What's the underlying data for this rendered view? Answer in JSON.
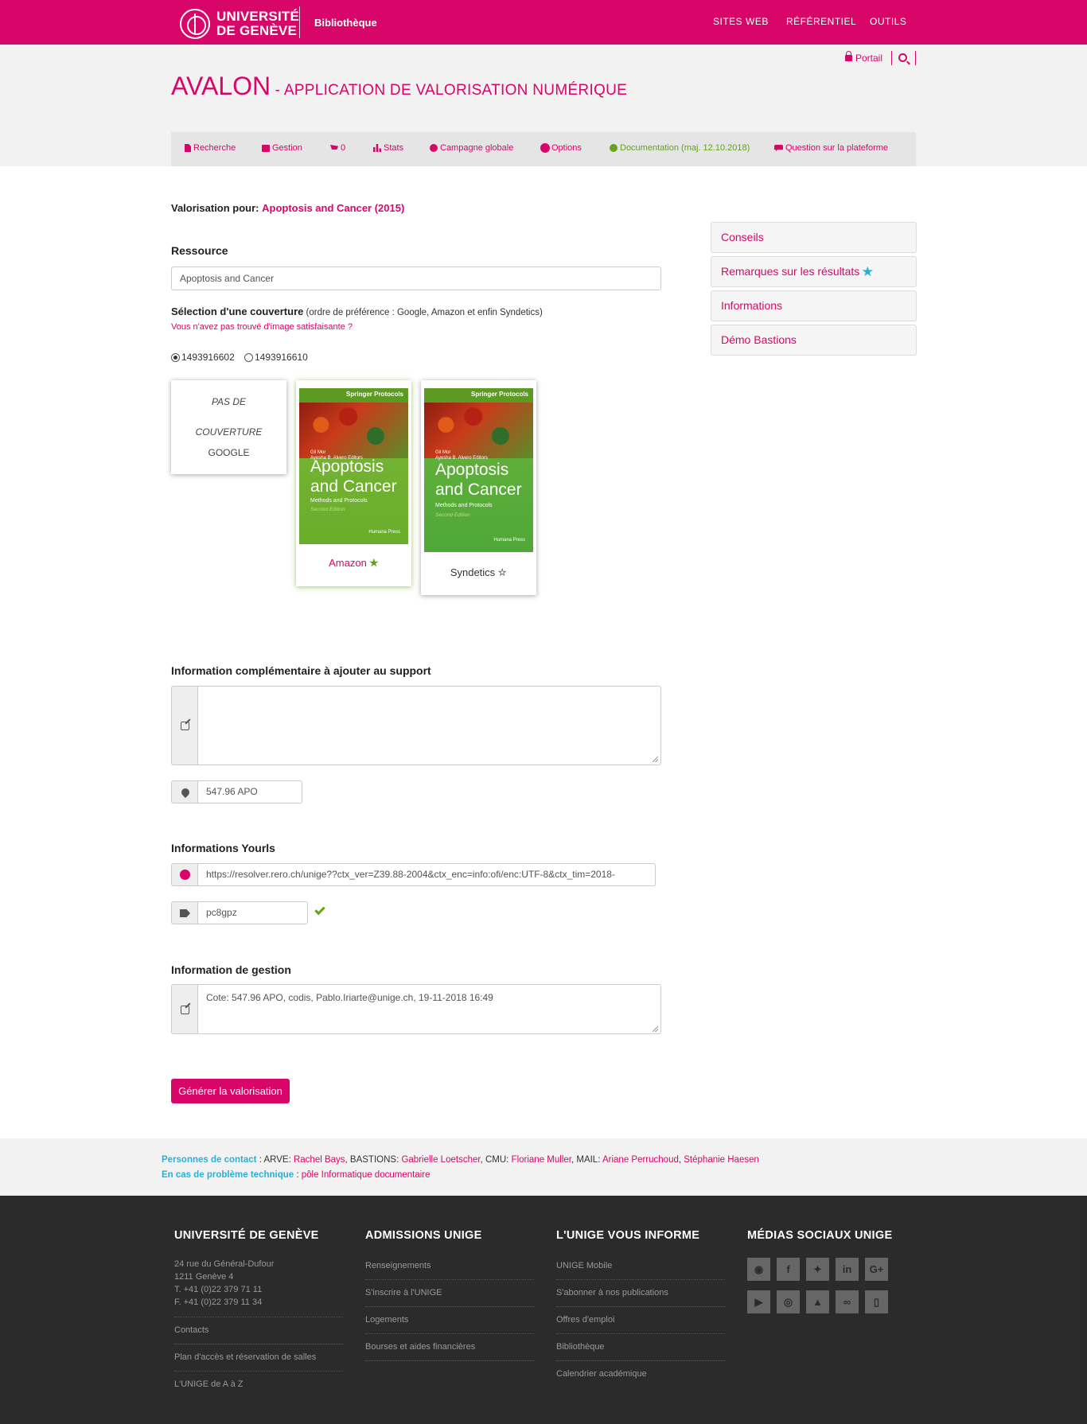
{
  "topbar": {
    "logo_line1": "UNIVERSITÉ",
    "logo_line2": "DE GENÈVE",
    "section": "Bibliothèque",
    "nav": [
      "SITES WEB",
      "RÉFÉRENTIEL",
      "OUTILS"
    ]
  },
  "header": {
    "portal_label": "Portail",
    "app_name": "AVALON",
    "app_subtitle": " - APPLICATION DE VALORISATION NUMÉRIQUE"
  },
  "appnav": {
    "search": "Recherche",
    "manage": "Gestion",
    "cart_count": "0",
    "stats": "Stats",
    "campaign": "Campagne globale",
    "options": "Options",
    "documentation": "Documentation (maj. 12.10.2018)",
    "question": "Question sur la plateforme"
  },
  "main": {
    "valorisation_label": "Valorisation pour:",
    "valorisation_title": "Apoptosis and Cancer (2015)",
    "resource_label": "Ressource",
    "resource_value": "Apoptosis and Cancer",
    "cover_label": "Sélection d'une couverture",
    "cover_pref": " (ordre de préférence : Google, Amazon et enfin Syndetics)",
    "no_image_link": "Vous n'avez pas trouvé d'image satisfaisante ?",
    "isbns": [
      "1493916602",
      "1493916610"
    ],
    "selected_isbn_index": 0,
    "covers": {
      "google_line1": "PAS DE",
      "google_line2": "COUVERTURE",
      "google_source": "GOOGLE",
      "amazon_label": "Amazon",
      "syndetics_label": "Syndetics",
      "book_series": "Springer Protocols",
      "book_authors_1": "Gil Mor",
      "book_authors_2": "Ayesha B. Alvero  Editors",
      "book_title_1": "Apoptosis",
      "book_title_2": "and Cancer",
      "book_subtitle": "Methods and Protocols",
      "book_edition": "Second Edition",
      "book_press": "Humana Press"
    },
    "info_label": "Information complémentaire à ajouter au support",
    "info_value": "",
    "call_number": "547.96 APO",
    "yourls_label": "Informations Yourls",
    "yourls_url": "https://resolver.rero.ch/unige??ctx_ver=Z39.88-2004&ctx_enc=info:ofi/enc:UTF-8&ctx_tim=2018-",
    "yourls_tag": "pc8gpz",
    "mgmt_label": "Information de gestion",
    "mgmt_value": "Cote: 547.96 APO, codis, Pablo.Iriarte@unige.ch, 19-11-2018 16:49",
    "generate_button": "Générer la valorisation"
  },
  "sidebar": {
    "items": [
      "Conseils",
      "Remarques sur les résultats",
      "Informations",
      "Démo Bastions"
    ]
  },
  "contact": {
    "persons_label": "Personnes de contact",
    "sep": " : ",
    "arve": "ARVE: ",
    "rachel": "Rachel Bays",
    "bastions": ", BASTIONS: ",
    "gabrielle": "Gabrielle Loetscher",
    "cmu": ", CMU: ",
    "floriane": "Floriane Muller",
    "mail": ", MAIL: ",
    "ariane": "Ariane Perruchoud",
    "comma": ", ",
    "stephanie": "Stéphanie Haesen",
    "tech_label": "En cas de problème technique",
    "tech_link": "pôle Informatique documentaire"
  },
  "footer": {
    "col1_head": "UNIVERSITÉ DE GENÈVE",
    "address": [
      "24 rue du Général-Dufour",
      "1211 Genève 4",
      "T. +41 (0)22 379 71 11",
      "F. +41 (0)22 379 11 34"
    ],
    "col1_links": [
      "Contacts",
      "Plan d'accès et réservation de salles",
      "L'UNIGE de A à Z"
    ],
    "col2_head": "ADMISSIONS UNIGE",
    "col2_links": [
      "Renseignements",
      "S'inscrire à l'UNIGE",
      "Logements",
      "Bourses et aides financières"
    ],
    "col3_head": "L'UNIGE VOUS INFORME",
    "col3_links": [
      "UNIGE Mobile",
      "S'abonner à nos publications",
      "Offres d'emploi",
      "Bibliothèque",
      "Calendrier académique"
    ],
    "col4_head": "MÉDIAS SOCIAUX UNIGE",
    "social_glyphs": [
      "◉",
      "f",
      "✦",
      "in",
      "G+",
      "▶",
      "◎",
      "▲",
      "∞",
      "▯"
    ]
  },
  "colors": {
    "brand": "#d80669",
    "accent_blue": "#2ab0d8",
    "accent_green": "#62a31b"
  }
}
